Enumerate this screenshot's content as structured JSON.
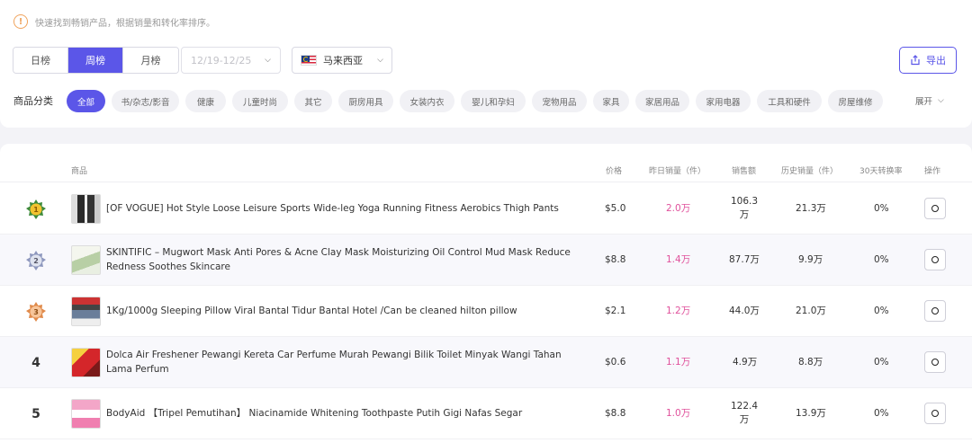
{
  "notice": {
    "icon": "warning-circle-icon",
    "text": "快速找到畅销产品，根据销量和转化率排序。"
  },
  "period_tabs": [
    {
      "label": "日榜",
      "active": false
    },
    {
      "label": "周榜",
      "active": true
    },
    {
      "label": "月榜",
      "active": false
    }
  ],
  "date_range": {
    "placeholder": "12/19-12/25"
  },
  "country": {
    "label": "马来西亚",
    "flag": "malaysia-flag-icon"
  },
  "export_label": "导出",
  "category": {
    "label": "商品分类",
    "expand_label": "展开",
    "items": [
      {
        "label": "全部",
        "active": true
      },
      {
        "label": "书/杂志/影音"
      },
      {
        "label": "健康"
      },
      {
        "label": "儿童时尚"
      },
      {
        "label": "其它"
      },
      {
        "label": "厨房用具"
      },
      {
        "label": "女装内衣"
      },
      {
        "label": "婴儿和孕妇"
      },
      {
        "label": "宠物用品"
      },
      {
        "label": "家具"
      },
      {
        "label": "家居用品"
      },
      {
        "label": "家用电器"
      },
      {
        "label": "工具和硬件"
      },
      {
        "label": "房屋维修"
      }
    ]
  },
  "table": {
    "headers": {
      "product": "商品",
      "price": "价格",
      "yesterday_sales": "昨日销量（件）",
      "revenue": "销售额",
      "history_sales": "历史销量（件）",
      "conversion": "30天转换率",
      "action": "操作"
    },
    "rows": [
      {
        "rank": "1",
        "medal": "gold-medal-icon",
        "name": "[OF VOGUE] Hot Style Loose Leisure Sports Wide-leg Yoga Running Fitness Aerobics Thigh Pants",
        "price": "$5.0",
        "yesterday": "2.0万",
        "revenue": "106.3万",
        "history": "21.3万",
        "conversion": "0%"
      },
      {
        "rank": "2",
        "medal": "silver-medal-icon",
        "name": "SKINTIFIC – Mugwort Mask Anti Pores & Acne Clay Mask Moisturizing Oil Control Mud Mask Reduce Redness Soothes Skincare",
        "price": "$8.8",
        "yesterday": "1.4万",
        "revenue": "87.7万",
        "history": "9.9万",
        "conversion": "0%"
      },
      {
        "rank": "3",
        "medal": "bronze-medal-icon",
        "name": "1Kg/1000g Sleeping Pillow Viral Bantal Tidur Bantal Hotel /Can be cleaned hilton pillow",
        "price": "$2.1",
        "yesterday": "1.2万",
        "revenue": "44.0万",
        "history": "21.0万",
        "conversion": "0%"
      },
      {
        "rank": "4",
        "medal": "",
        "name": "Dolca Air Freshener Pewangi Kereta Car Perfume Murah Pewangi Bilik Toilet Minyak Wangi Tahan Lama Perfum",
        "price": "$0.6",
        "yesterday": "1.1万",
        "revenue": "4.9万",
        "history": "8.8万",
        "conversion": "0%"
      },
      {
        "rank": "5",
        "medal": "",
        "name": "BodyAid 【Tripel Pemutihan】 Niacinamide Whitening Toothpaste Putih Gigi Nafas Segar",
        "price": "$8.8",
        "yesterday": "1.0万",
        "revenue": "122.4万",
        "history": "13.9万",
        "conversion": "0%"
      }
    ]
  },
  "colors": {
    "accent": "#5b56e8",
    "pink": "#e0529c",
    "gold": "#e6b800",
    "silver": "#9aa4c8",
    "bronze": "#e08a4a"
  }
}
